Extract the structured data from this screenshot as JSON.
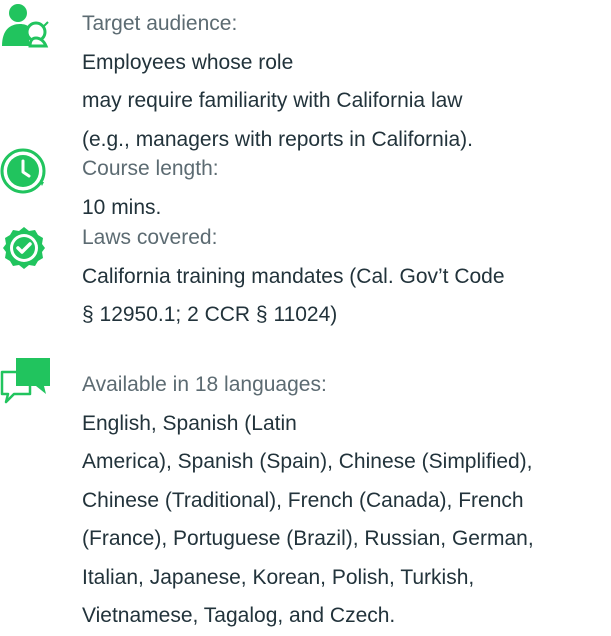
{
  "items": [
    {
      "icon": "person-search-icon",
      "label": "Target audience:",
      "lines": [
        "Employees whose role",
        "may require familiarity with California law",
        "(e.g., managers with reports in California)."
      ]
    },
    {
      "icon": "clock-icon",
      "label": "Course length:",
      "value": "10 mins."
    },
    {
      "icon": "check-badge-icon",
      "label": "Laws covered:",
      "lines": [
        "California training mandates (Cal. Gov’t Code",
        "§ 12950.1; 2 CCR § 11024)"
      ]
    },
    {
      "icon": "chat-bubbles-icon",
      "label": "Available in 18 languages:",
      "lines": [
        "English, Spanish (Latin",
        "America), Spanish (Spain), Chinese (Simplified),",
        "Chinese (Traditional), French (Canada), French",
        "(France), Portuguese (Brazil), Russian, German,",
        "Italian, Japanese, Korean, Polish, Turkish,",
        "Vietnamese, Tagalog, and Czech."
      ]
    }
  ],
  "colors": {
    "accent": "#21c45e",
    "text": "#22333b",
    "label": "#5c6b72"
  }
}
